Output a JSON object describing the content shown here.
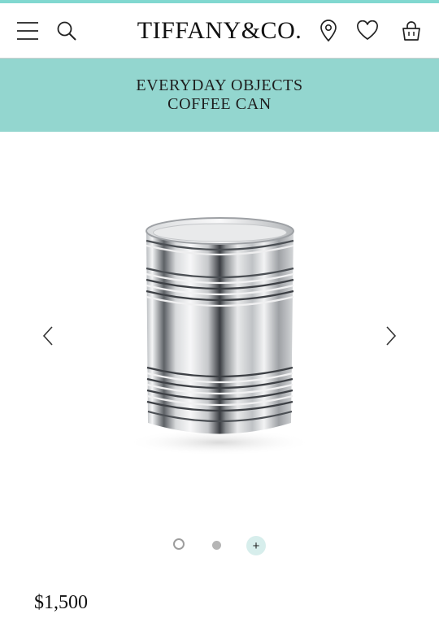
{
  "header": {
    "brand": "TIFFANY&CO.",
    "icons": [
      "menu-icon",
      "search-icon",
      "location-pin-icon",
      "heart-icon",
      "shopping-bag-icon"
    ]
  },
  "banner": {
    "category": "EVERYDAY OBJECTS",
    "product_name": "COFFEE CAN"
  },
  "carousel": {
    "image_alt": "silver coffee can",
    "slides": [
      "image-1",
      "image-2",
      "more"
    ],
    "active_index": 0,
    "more_label": "+"
  },
  "product": {
    "price": "$1,500"
  },
  "colors": {
    "accent": "#81d8d0",
    "banner": "#93d6cf"
  }
}
